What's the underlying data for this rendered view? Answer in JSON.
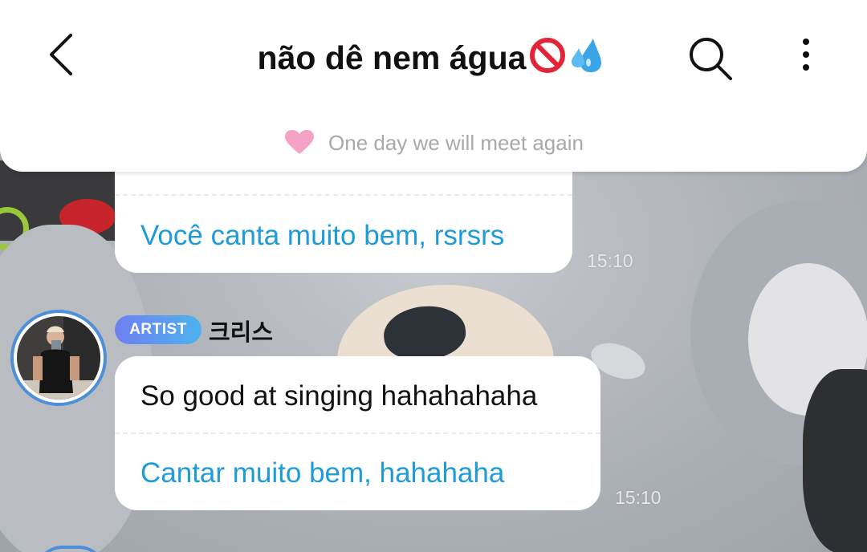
{
  "header": {
    "title": "não dê nem água",
    "title_emojis": [
      "no-entry-sign-emoji",
      "sweat-droplets-emoji"
    ],
    "status": "One day we will meet again",
    "icons": {
      "back": "chevron-left-icon",
      "search": "search-icon",
      "more": "vertical-ellipsis-icon",
      "status": "pink-heart-icon"
    }
  },
  "messages": [
    {
      "translation": "Você canta muito bem, rsrsrs",
      "time": "15:10"
    },
    {
      "badge": "ARTIST",
      "sender": "크리스",
      "original": "So good at singing hahahahaha",
      "translation": "Cantar muito bem, hahahaha",
      "time": "15:10"
    }
  ],
  "colors": {
    "translation_text": "#1e9bd8",
    "avatar_ring": "#4e8fd9",
    "badge_gradient_start": "#6f7ff0",
    "badge_gradient_end": "#4db3ef",
    "status_text": "#a9a9ad",
    "heart": "#f5a3c4"
  }
}
